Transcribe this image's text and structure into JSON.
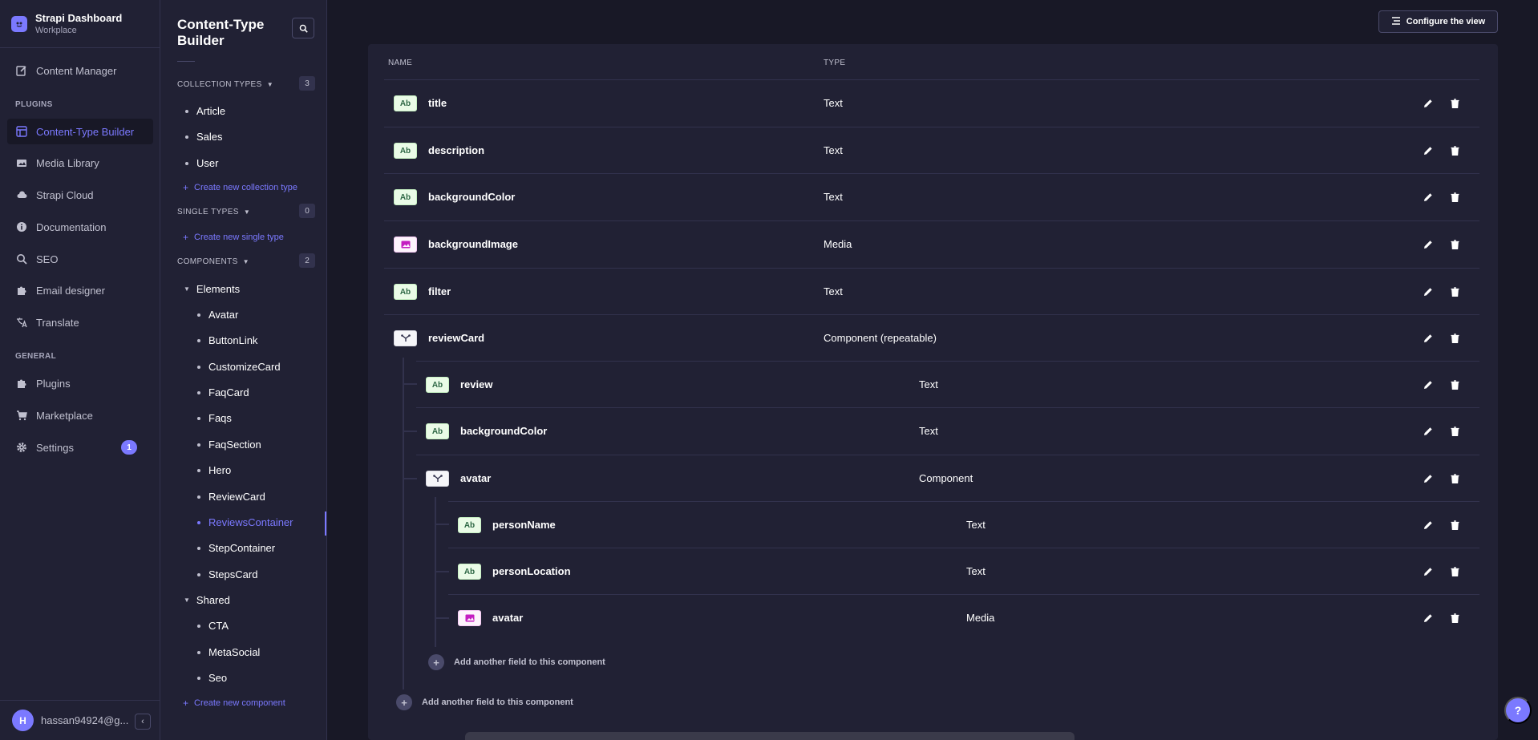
{
  "brand": {
    "title": "Strapi Dashboard",
    "subtitle": "Workplace",
    "logo_icon": "strapi-logo-icon"
  },
  "mainnav": {
    "items": [
      {
        "label": "Content Manager",
        "icon": "pen-square-icon"
      },
      {
        "label": "Content-Type Builder",
        "icon": "layout-icon",
        "active": true
      },
      {
        "label": "Media Library",
        "icon": "images-icon"
      },
      {
        "label": "Strapi Cloud",
        "icon": "cloud-icon"
      },
      {
        "label": "Documentation",
        "icon": "info-icon"
      },
      {
        "label": "SEO",
        "icon": "search-icon"
      },
      {
        "label": "Email designer",
        "icon": "puzzle-icon"
      },
      {
        "label": "Translate",
        "icon": "translate-icon"
      },
      {
        "label": "Plugins",
        "icon": "puzzle-icon"
      },
      {
        "label": "Marketplace",
        "icon": "cart-icon"
      },
      {
        "label": "Settings",
        "icon": "gear-icon",
        "badge": "1"
      }
    ],
    "section_plugins": "PLUGINS",
    "section_general": "GENERAL"
  },
  "user": {
    "initial": "H",
    "email": "hassan94924@g..."
  },
  "subnav": {
    "title": "Content-Type Builder",
    "collection_types": {
      "label": "COLLECTION TYPES",
      "count": "3",
      "items": [
        "Article",
        "Sales",
        "User"
      ],
      "create_label": "Create new collection type"
    },
    "single_types": {
      "label": "SINGLE TYPES",
      "count": "0",
      "create_label": "Create new single type"
    },
    "components": {
      "label": "COMPONENTS",
      "count": "2",
      "groups": [
        {
          "name": "Elements",
          "items": [
            "Avatar",
            "ButtonLink",
            "CustomizeCard",
            "FaqCard",
            "Faqs",
            "FaqSection",
            "Hero",
            "ReviewCard",
            "ReviewsContainer",
            "StepContainer",
            "StepsCard"
          ],
          "active_index": 8
        },
        {
          "name": "Shared",
          "items": [
            "CTA",
            "MetaSocial",
            "Seo"
          ]
        }
      ],
      "create_label": "Create new component"
    }
  },
  "toolbar": {
    "configure_label": "Configure the view"
  },
  "table": {
    "col_name": "NAME",
    "col_type": "TYPE",
    "rows": [
      {
        "name": "title",
        "type": "Text",
        "tag": "Ab",
        "kind": "text"
      },
      {
        "name": "description",
        "type": "Text",
        "tag": "Ab",
        "kind": "text"
      },
      {
        "name": "backgroundColor",
        "type": "Text",
        "tag": "Ab",
        "kind": "text"
      },
      {
        "name": "backgroundImage",
        "type": "Media",
        "tag": "",
        "kind": "media"
      },
      {
        "name": "filter",
        "type": "Text",
        "tag": "Ab",
        "kind": "text"
      },
      {
        "name": "reviewCard",
        "type": "Component (repeatable)",
        "tag": "",
        "kind": "comp"
      },
      {
        "name": "review",
        "type": "Text",
        "tag": "Ab",
        "kind": "text"
      },
      {
        "name": "backgroundColor",
        "type": "Text",
        "tag": "Ab",
        "kind": "text"
      },
      {
        "name": "avatar",
        "type": "Component",
        "tag": "",
        "kind": "comp"
      },
      {
        "name": "personName",
        "type": "Text",
        "tag": "Ab",
        "kind": "text"
      },
      {
        "name": "personLocation",
        "type": "Text",
        "tag": "Ab",
        "kind": "text"
      },
      {
        "name": "avatar",
        "type": "Media",
        "tag": "",
        "kind": "media"
      }
    ],
    "add_field_inner": "Add another field to this component",
    "add_field_outer": "Add another field to this component"
  },
  "help": {
    "label": "?"
  },
  "colors": {
    "accent": "#7b79ff",
    "bg": "#181826",
    "panel": "#212134",
    "border": "#32324d"
  }
}
